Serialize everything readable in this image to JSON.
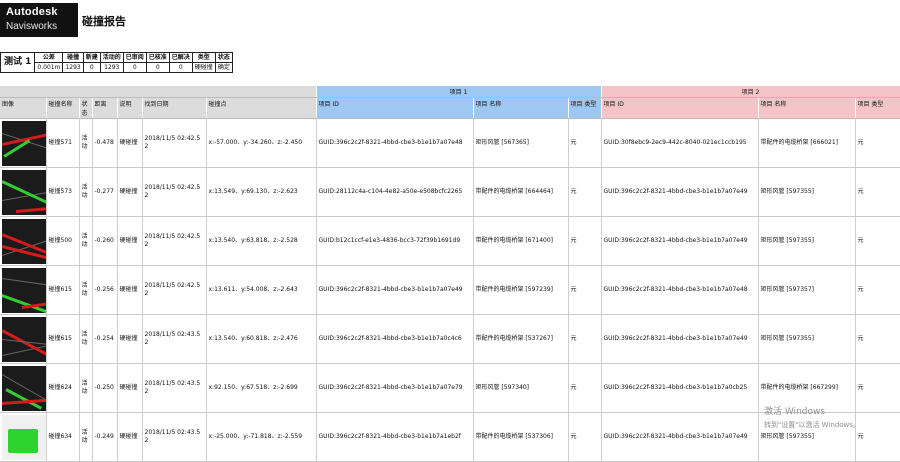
{
  "header": {
    "logo_line1": "Autodesk",
    "logo_line2": "Navisworks",
    "title": "碰撞报告"
  },
  "summary": {
    "test_name": "测试 1",
    "tolerance_label": "公差",
    "tolerance_value": "0.001m",
    "cols": [
      "碰撞",
      "新建",
      "活动的",
      "已审阅",
      "已核准",
      "已解决",
      "类型",
      "状态"
    ],
    "values": [
      "1293",
      "0",
      "1293",
      "0",
      "0",
      "0",
      "硬碰撞",
      "确定"
    ]
  },
  "table": {
    "group_item1": "项目 1",
    "group_item2": "项目 2",
    "headers": {
      "image": "图像",
      "clash_name": "碰撞名称",
      "status": "状态",
      "distance": "距离",
      "description": "说明",
      "found_date": "找到日期",
      "clash_point": "碰撞点",
      "item_id": "项目 ID",
      "item_name": "项目 名称",
      "item_type": "项目 类型"
    },
    "rows": [
      {
        "name": "碰撞571",
        "status": "活动",
        "distance": "-0.478",
        "desc": "硬碰撞",
        "date": "2018/11/5 02:42.52",
        "point": "x:-57.000、y:-34.260、z:-2.450",
        "id1": "GUID:396c2c2f-8321-4bbd-cbe3-b1e1b7a07e48",
        "name1": "矩形风管 [567365]",
        "type1": "元",
        "id2": "GUID:30f8ebc9-2ec9-442c-8040-021ec1ccb195",
        "name2": "带配件的电缆桥架 [666021]",
        "type2": "元"
      },
      {
        "name": "碰撞573",
        "status": "活动",
        "distance": "-0.277",
        "desc": "硬碰撞",
        "date": "2018/11/5 02:42.52",
        "point": "x:13.549、y:69.130、z:-2.623",
        "id1": "GUID:28112c4a-c104-4e82-a50e-e508bcfc2265",
        "name1": "带配件的电缆桥架 [664464]",
        "type1": "元",
        "id2": "GUID:396c2c2f-8321-4bbd-cbe3-b1e1b7a07e49",
        "name2": "矩形风管 [597355]",
        "type2": "元"
      },
      {
        "name": "碰撞500",
        "status": "活动",
        "distance": "-0.260",
        "desc": "硬碰撞",
        "date": "2018/11/5 02:42.52",
        "point": "x:13.540、y:63.818、z:-2.528",
        "id1": "GUID:b12c1ccf-e1e3-4836-bcc3-72f39b1691d9",
        "name1": "带配件的电缆桥架 [671400]",
        "type1": "元",
        "id2": "GUID:396c2c2f-8321-4bbd-cbe3-b1e1b7a07e49",
        "name2": "矩形风管 [597355]",
        "type2": "元"
      },
      {
        "name": "碰撞615",
        "status": "活动",
        "distance": "-0.256",
        "desc": "硬碰撞",
        "date": "2018/11/5 02:42.52",
        "point": "x:13.611、y:54.008、z:-2.643",
        "id1": "GUID:396c2c2f-8321-4bbd-cbe3-b1e1b7a07e49",
        "name1": "带配件的电缆桥架 [597239]",
        "type1": "元",
        "id2": "GUID:396c2c2f-8321-4bbd-cbe3-b1e1b7a07e48",
        "name2": "矩形风管 [597357]",
        "type2": "元"
      },
      {
        "name": "碰撞615",
        "status": "活动",
        "distance": "-0.254",
        "desc": "硬碰撞",
        "date": "2018/11/5 02:43.52",
        "point": "x:13.540、y:60.818、z:-2.476",
        "id1": "GUID:396c2c2f-8321-4bbd-cbe3-b1e1b7a0c4c6",
        "name1": "带配件的电缆桥架 [537267]",
        "type1": "元",
        "id2": "GUID:396c2c2f-8321-4bbd-cbe3-b1e1b7a07e49",
        "name2": "矩形风管 [597355]",
        "type2": "元"
      },
      {
        "name": "碰撞624",
        "status": "活动",
        "distance": "-0.250",
        "desc": "硬碰撞",
        "date": "2018/11/5 02:43.52",
        "point": "x:92.150、y:67.518、z:-2.699",
        "id1": "GUID:396c2c2f-8321-4bbd-cbe3-b1e1b7a07e79",
        "name1": "矩形风管 [597340]",
        "type1": "元",
        "id2": "GUID:396c2c2f-8321-4bbd-cbe3-b1e1b7a0cb25",
        "name2": "带配件的电缆桥架 [667299]",
        "type2": "元"
      },
      {
        "name": "碰撞634",
        "status": "活动",
        "distance": "-0.249",
        "desc": "硬碰撞",
        "date": "2018/11/5 02:43.52",
        "point": "x:-25.000、y:-71.818、z:-2.559",
        "id1": "GUID:396c2c2f-8321-4bbd-cbe3-b1e1b7a1eb2f",
        "name1": "带配件的电缆桥架 [537306]",
        "type1": "元",
        "id2": "GUID:396c2c2f-8321-4bbd-cbe3-b1e1b7a07e49",
        "name2": "矩形风管 [597355]",
        "type2": "元"
      }
    ]
  },
  "watermark": {
    "line1": "激活 Windows",
    "line2": "转到\"设置\"以激活 Windows。"
  },
  "colors": {
    "header_grey": "#dcdcdc",
    "item1_blue": "#9dc8f2",
    "item2_pink": "#f5c4c6",
    "clash_red": "#d41c1c",
    "clash_green": "#33cc33"
  }
}
